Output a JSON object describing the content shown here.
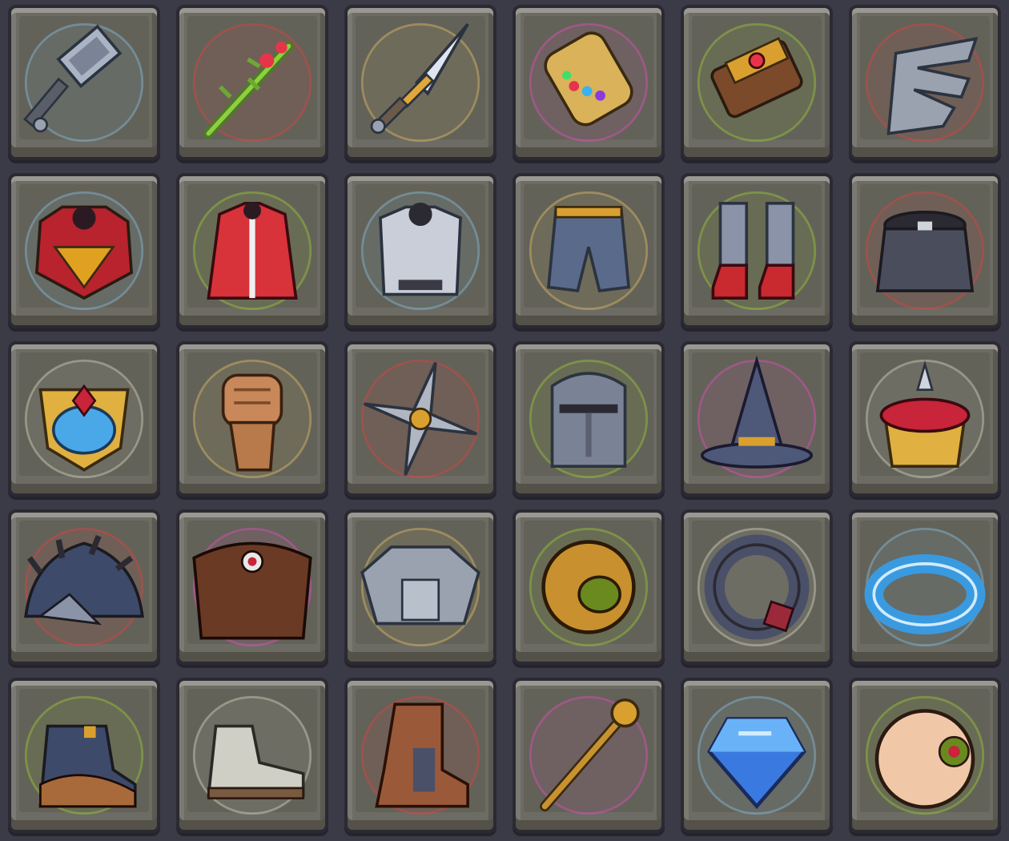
{
  "inventory": {
    "slots": [
      {
        "icon": "hammer-icon",
        "rarity_color": "#8fd3ff"
      },
      {
        "icon": "flaming-branch-staff-icon",
        "rarity_color": "#ff3a3a"
      },
      {
        "icon": "dagger-icon",
        "rarity_color": "#ffd36a"
      },
      {
        "icon": "gem-gauntlet-icon",
        "rarity_color": "#ff4ad2"
      },
      {
        "icon": "ruby-bracer-icon",
        "rarity_color": "#a8e62c"
      },
      {
        "icon": "steel-claw-icon",
        "rarity_color": "#ff3a3a"
      },
      {
        "icon": "hero-chest-armor-icon",
        "rarity_color": "#8fd3ff"
      },
      {
        "icon": "red-robe-icon",
        "rarity_color": "#a8e62c"
      },
      {
        "icon": "chainmail-vest-icon",
        "rarity_color": "#8fd3ff"
      },
      {
        "icon": "leather-pants-icon",
        "rarity_color": "#ffd36a"
      },
      {
        "icon": "red-boots-icon",
        "rarity_color": "#a8e62c"
      },
      {
        "icon": "chain-skirt-icon",
        "rarity_color": "#ff3a3a"
      },
      {
        "icon": "royal-amulet-icon",
        "rarity_color": "#f2f0d8"
      },
      {
        "icon": "fist-icon",
        "rarity_color": "#ffd36a"
      },
      {
        "icon": "shuriken-icon",
        "rarity_color": "#ff3a3a"
      },
      {
        "icon": "great-helm-icon",
        "rarity_color": "#a8e62c"
      },
      {
        "icon": "wizard-hat-icon",
        "rarity_color": "#ff4ad2"
      },
      {
        "icon": "jeweled-crown-icon",
        "rarity_color": "#f2f0d8"
      },
      {
        "icon": "spiked-pauldron-icon",
        "rarity_color": "#ff3a3a"
      },
      {
        "icon": "fur-cloak-icon",
        "rarity_color": "#ff4ad2"
      },
      {
        "icon": "plate-armor-icon",
        "rarity_color": "#ffd36a"
      },
      {
        "icon": "golden-rune-ring-icon",
        "rarity_color": "#a8e62c"
      },
      {
        "icon": "gem-ring-icon",
        "rarity_color": "#f2f0d8"
      },
      {
        "icon": "ice-ring-icon",
        "rarity_color": "#8fd3ff"
      },
      {
        "icon": "fur-boot-icon",
        "rarity_color": "#a8e62c"
      },
      {
        "icon": "white-shoe-icon",
        "rarity_color": "#f2f0d8"
      },
      {
        "icon": "leather-boot-icon",
        "rarity_color": "#ff3a3a"
      },
      {
        "icon": "scepter-icon",
        "rarity_color": "#ff4ad2"
      },
      {
        "icon": "blue-gem-icon",
        "rarity_color": "#8fd3ff"
      },
      {
        "icon": "eyeball-icon",
        "rarity_color": "#a8e62c"
      }
    ]
  }
}
